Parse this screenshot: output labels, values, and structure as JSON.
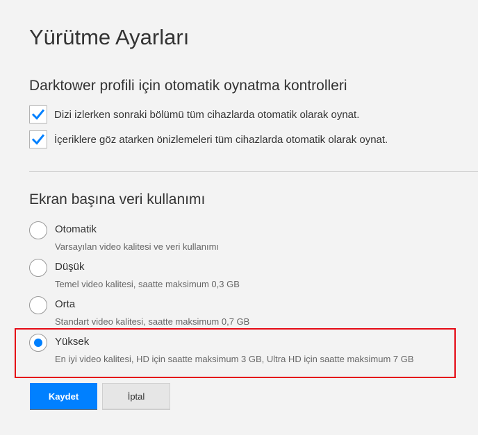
{
  "page": {
    "title": "Yürütme Ayarları"
  },
  "autoplay": {
    "heading": "Darktower profili için otomatik oynatma kontrolleri",
    "options": [
      {
        "label": "Dizi izlerken sonraki bölümü tüm cihazlarda otomatik olarak oynat.",
        "checked": true
      },
      {
        "label": "İçeriklere göz atarken önizlemeleri tüm cihazlarda otomatik olarak oynat.",
        "checked": true
      }
    ]
  },
  "data_usage": {
    "heading": "Ekran başına veri kullanımı",
    "selected": "Yüksek",
    "options": [
      {
        "label": "Otomatik",
        "description": "Varsayılan video kalitesi ve veri kullanımı",
        "selected": false
      },
      {
        "label": "Düşük",
        "description": "Temel video kalitesi, saatte maksimum 0,3 GB",
        "selected": false
      },
      {
        "label": "Orta",
        "description": "Standart video kalitesi, saatte maksimum 0,7 GB",
        "selected": false
      },
      {
        "label": "Yüksek",
        "description": "En iyi video kalitesi, HD için saatte maksimum 3 GB, Ultra HD için saatte maksimum 7 GB",
        "selected": true
      }
    ]
  },
  "buttons": {
    "save_label": "Kaydet",
    "cancel_label": "İptal"
  },
  "icons": {
    "checkbox_check": "checkmark-icon"
  },
  "colors": {
    "accent_blue": "#0080ff",
    "highlight_red": "#e50914",
    "background": "#f3f3f3"
  }
}
